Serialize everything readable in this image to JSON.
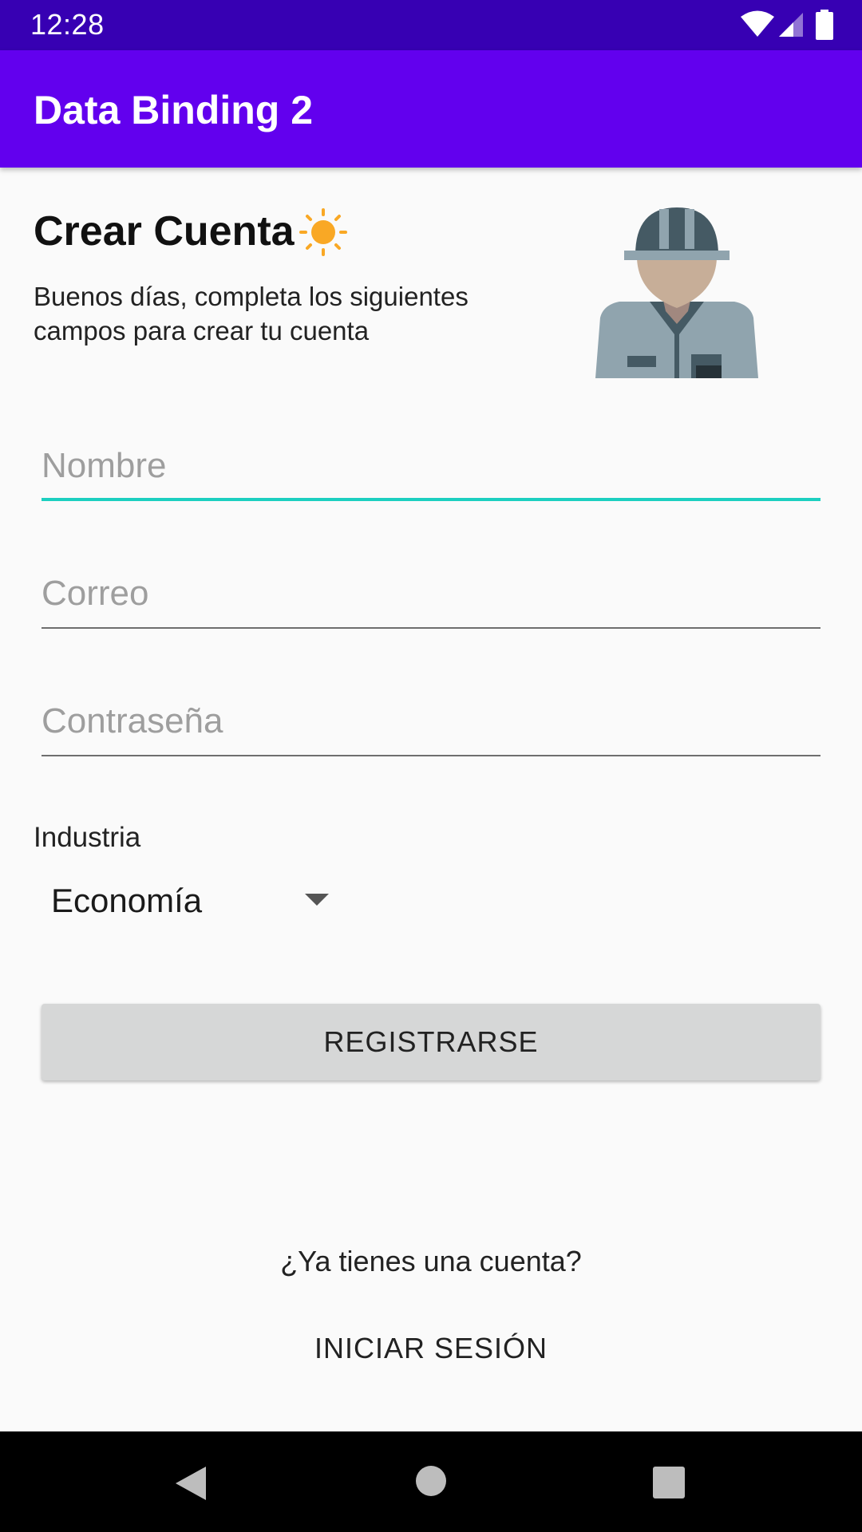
{
  "status_bar": {
    "time": "12:28",
    "icons": [
      "wifi-icon",
      "signal-icon",
      "battery-icon"
    ],
    "background": "#3700b3"
  },
  "app_bar": {
    "title": "Data Binding 2",
    "background": "#6200ee"
  },
  "header": {
    "title": "Crear Cuenta",
    "title_icon": "sun-icon",
    "description": "Buenos días, completa los siguientes campos para crear tu cuenta",
    "illustration": "worker-illustration"
  },
  "form": {
    "name": {
      "placeholder": "Nombre",
      "value": ""
    },
    "email": {
      "placeholder": "Correo",
      "value": ""
    },
    "password": {
      "placeholder": "Contraseña",
      "value": ""
    },
    "industry_label": "Industria",
    "industry_selected": "Economía",
    "register_label": "REGISTRARSE"
  },
  "footer": {
    "question": "¿Ya tienes una cuenta?",
    "login_label": "INICIAR SESIÓN"
  },
  "nav_bar": {
    "icons": [
      "back-icon",
      "home-icon",
      "recents-icon"
    ]
  },
  "colors": {
    "accent": "#1ccfc0",
    "sun": "#f9a825",
    "button_bg": "#d6d7d7"
  }
}
